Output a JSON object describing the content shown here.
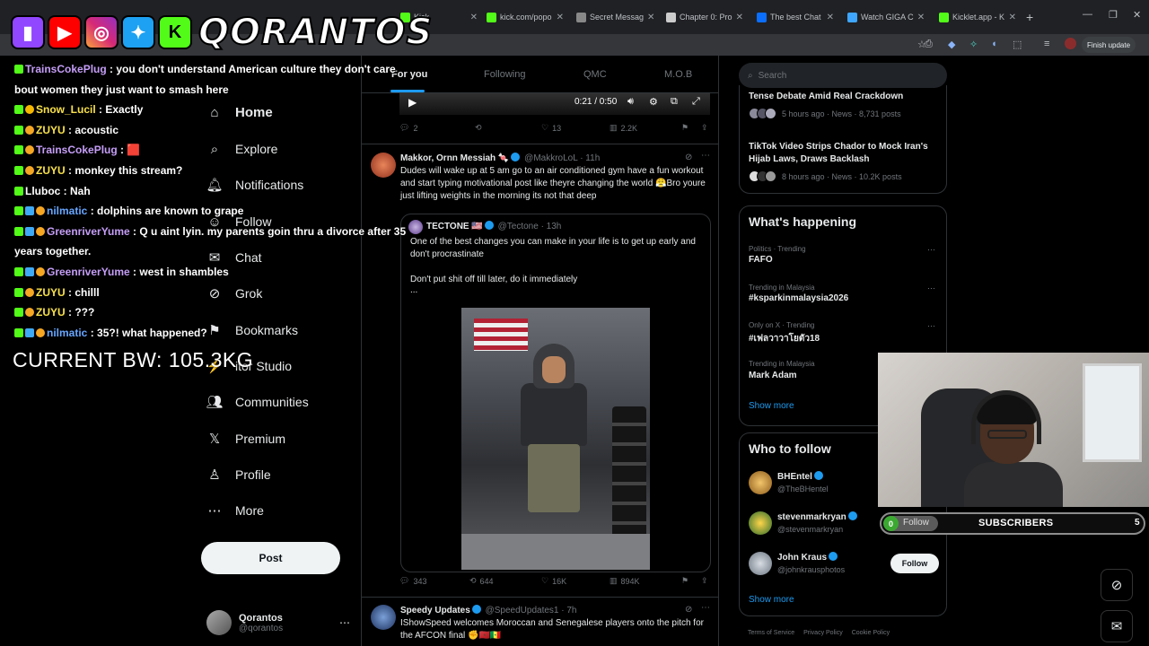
{
  "browser": {
    "tabs": [
      {
        "label": "Kick",
        "color": "#53fc18"
      },
      {
        "label": "kick.com/popo",
        "color": "#53fc18"
      },
      {
        "label": "Secret Messag",
        "color": "#888888"
      },
      {
        "label": "Chapter 0: Pro",
        "color": "#cccccc"
      },
      {
        "label": "The best Chat",
        "color": "#0b6efd"
      },
      {
        "label": "Watch GIGA C",
        "color": "#3ea6ff"
      },
      {
        "label": "Kicklet.app - K",
        "color": "#53fc18"
      }
    ],
    "finish_update": "Finish update"
  },
  "banner": {
    "name": "QORANTOS"
  },
  "chat": [
    {
      "user": "TrainsCokePlug",
      "msg": " : you don't understand American culture they don't care bout women they just want to smash here",
      "badges": [
        "k"
      ],
      "color": "purple"
    },
    {
      "user": "Snow_Lucil",
      "msg": " : Exactly",
      "badges": [
        "k",
        "star"
      ],
      "color": "yellow"
    },
    {
      "user": "ZUYU",
      "msg": " : acoustic",
      "badges": [
        "k",
        "warn"
      ],
      "color": "yellow"
    },
    {
      "user": "TrainsCokePlug",
      "msg": " : 🟥",
      "badges": [
        "k",
        "warn"
      ],
      "color": "purple"
    },
    {
      "user": "ZUYU",
      "msg": " : monkey this stream?",
      "badges": [
        "k",
        "warn"
      ],
      "color": "yellow"
    },
    {
      "user": "Lluboc",
      "msg": " : Nah",
      "badges": [
        "k"
      ],
      "color": "white"
    },
    {
      "user": "nilmatic",
      "msg": " : dolphins are known to grape",
      "badges": [
        "k",
        "gem",
        "warn"
      ],
      "color": "blue"
    },
    {
      "user": "GreenriverYume",
      "msg": " : Q u aint lyin. my parents goin thru a divorce after 35 years together.",
      "badges": [
        "k",
        "gem",
        "warn"
      ],
      "color": "purple"
    },
    {
      "user": "GreenriverYume",
      "msg": " : west in shambles",
      "badges": [
        "k",
        "gem",
        "warn"
      ],
      "color": "purple"
    },
    {
      "user": "ZUYU",
      "msg": " : chilll",
      "badges": [
        "k",
        "warn"
      ],
      "color": "yellow"
    },
    {
      "user": "ZUYU",
      "msg": " : ???",
      "badges": [
        "k",
        "warn"
      ],
      "color": "yellow"
    },
    {
      "user": "nilmatic",
      "msg": " : 35?! what happened?",
      "badges": [
        "k",
        "gem",
        "warn"
      ],
      "color": "blue"
    }
  ],
  "bodyweight": "CURRENT BW: 105.3KG",
  "nav": {
    "items": [
      {
        "label": "Home",
        "icon": "home-icon"
      },
      {
        "label": "Explore",
        "icon": "search-icon"
      },
      {
        "label": "Notifications",
        "icon": "bell-icon"
      },
      {
        "label": "Follow",
        "icon": "follow-icon"
      },
      {
        "label": "Chat",
        "icon": "mail-icon"
      },
      {
        "label": "Grok",
        "icon": "grok-icon"
      },
      {
        "label": "Bookmarks",
        "icon": "bookmark-icon"
      },
      {
        "label": "itor Studio",
        "icon": "studio-icon"
      },
      {
        "label": "Communities",
        "icon": "communities-icon"
      },
      {
        "label": "Premium",
        "icon": "x-icon"
      },
      {
        "label": "Profile",
        "icon": "profile-icon"
      },
      {
        "label": "More",
        "icon": "more-icon"
      }
    ],
    "post_label": "Post",
    "account": {
      "name": "Qorantos",
      "handle": "@qorantos"
    }
  },
  "feed": {
    "tabs": [
      "For you",
      "Following",
      "QMC",
      "M.O.B"
    ],
    "video": {
      "time": "0:21 / 0:50"
    },
    "tweet0_actions": {
      "replies": "2",
      "likes": "13",
      "views": "2.2K"
    },
    "tweet1": {
      "name": "Makkor, Ornn Messiah 🍬",
      "handle": "@MakkroLoL",
      "time": "· 11h",
      "text": "Dudes will wake up at 5 am go to an air conditioned gym have a fun workout and start typing motivational post like theyre changing the world 😤Bro youre just lifting weights in the morning its not that deep",
      "quote": {
        "name": "TECTONE 🇺🇸",
        "handle": "@Tectone",
        "time": "· 13h",
        "text1": "One of the best changes you can make in your life is to get up early and don't procrastinate",
        "text2": "Don't put shit off till later, do it immediately",
        "ellipsis": "..."
      },
      "actions": {
        "replies": "343",
        "reposts": "644",
        "likes": "16K",
        "views": "894K"
      }
    },
    "tweet2": {
      "name": "Speedy Updates",
      "handle": "@SpeedUpdates1",
      "time": "· 7h",
      "text": "IShowSpeed welcomes Moroccan and Senegalese players onto the pitch for the AFCON final ✊🇲🇦🇸🇳"
    }
  },
  "right": {
    "search_placeholder": "Search",
    "news": [
      {
        "title": "Tense Debate Amid Real Crackdown",
        "meta": "5 hours ago · News · 8,731 posts"
      },
      {
        "title": "TikTok Video Strips Chador to Mock Iran's Hijab Laws, Draws Backlash",
        "meta": "8 hours ago · News · 10.2K posts"
      }
    ],
    "happening_title": "What's happening",
    "trends": [
      {
        "context": "Politics · Trending",
        "name": "FAFO"
      },
      {
        "context": "Trending in Malaysia",
        "name": "#ksparkinmalaysia2026"
      },
      {
        "context": "Only on X · Trending",
        "name": "#เฟลวาวาโยตัว18"
      },
      {
        "context": "Trending in Malaysia",
        "name": "Mark Adam"
      }
    ],
    "show_more": "Show more",
    "wtf_title": "Who to follow",
    "who_to_follow": [
      {
        "name": "BHEntel",
        "handle": "@TheBHentel"
      },
      {
        "name": "stevenmarkryan",
        "handle": "@stevenmarkryan"
      },
      {
        "name": "John Kraus",
        "handle": "@johnkrausphotos",
        "button": "Follow"
      }
    ],
    "footer": [
      "Terms of Service",
      "Privacy Policy",
      "Cookie Policy"
    ]
  },
  "subs": {
    "count": "0",
    "follow": "Follow",
    "label": "SUBSCRIBERS",
    "goal": "5"
  }
}
